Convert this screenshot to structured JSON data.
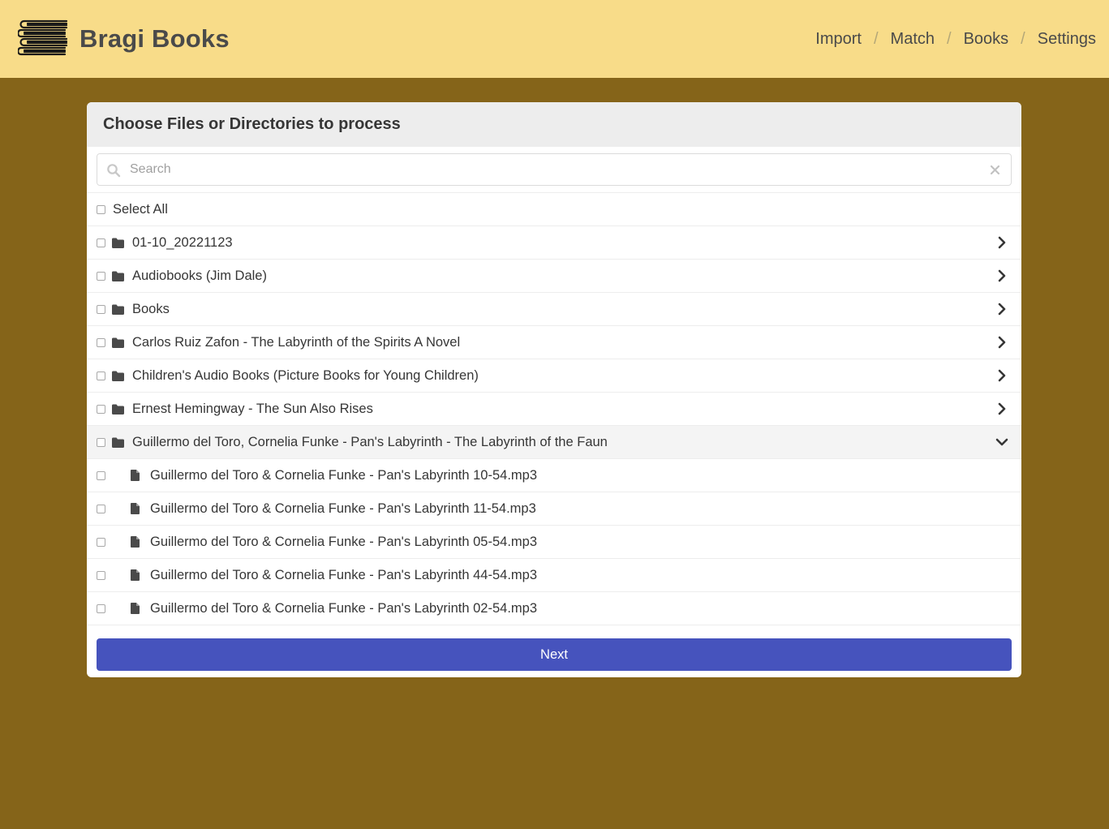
{
  "app": {
    "title": "Bragi Books",
    "logo_icon": "stacked-books-icon"
  },
  "nav": {
    "items": [
      {
        "label": "Import"
      },
      {
        "label": "Match"
      },
      {
        "label": "Books"
      },
      {
        "label": "Settings"
      }
    ],
    "separator": "/"
  },
  "colors": {
    "navbar_bg": "#f8dc89",
    "page_bg": "#856419",
    "primary_button": "#4653bd"
  },
  "panel": {
    "heading": "Choose Files or Directories to process",
    "search": {
      "placeholder": "Search",
      "value": "",
      "icon": "search-icon",
      "clear_icon": "close-icon"
    },
    "select_all_label": "Select All",
    "folders": [
      {
        "name": "01-10_20221123",
        "expanded": false
      },
      {
        "name": "Audiobooks (Jim Dale)",
        "expanded": false
      },
      {
        "name": "Books",
        "expanded": false
      },
      {
        "name": "Carlos Ruiz Zafon - The Labyrinth of the Spirits A Novel",
        "expanded": false
      },
      {
        "name": "Children's Audio Books (Picture Books for Young Children)",
        "expanded": false
      },
      {
        "name": "Ernest Hemingway - The Sun Also Rises",
        "expanded": false
      },
      {
        "name": "Guillermo del Toro, Cornelia Funke - Pan's Labyrinth - The Labyrinth of the Faun",
        "expanded": true
      }
    ],
    "files": [
      {
        "name": "Guillermo del Toro & Cornelia Funke - Pan's Labyrinth 10-54.mp3"
      },
      {
        "name": "Guillermo del Toro & Cornelia Funke - Pan's Labyrinth 11-54.mp3"
      },
      {
        "name": "Guillermo del Toro & Cornelia Funke - Pan's Labyrinth 05-54.mp3"
      },
      {
        "name": "Guillermo del Toro & Cornelia Funke - Pan's Labyrinth 44-54.mp3"
      },
      {
        "name": "Guillermo del Toro & Cornelia Funke - Pan's Labyrinth 02-54.mp3"
      }
    ],
    "next_label": "Next"
  }
}
